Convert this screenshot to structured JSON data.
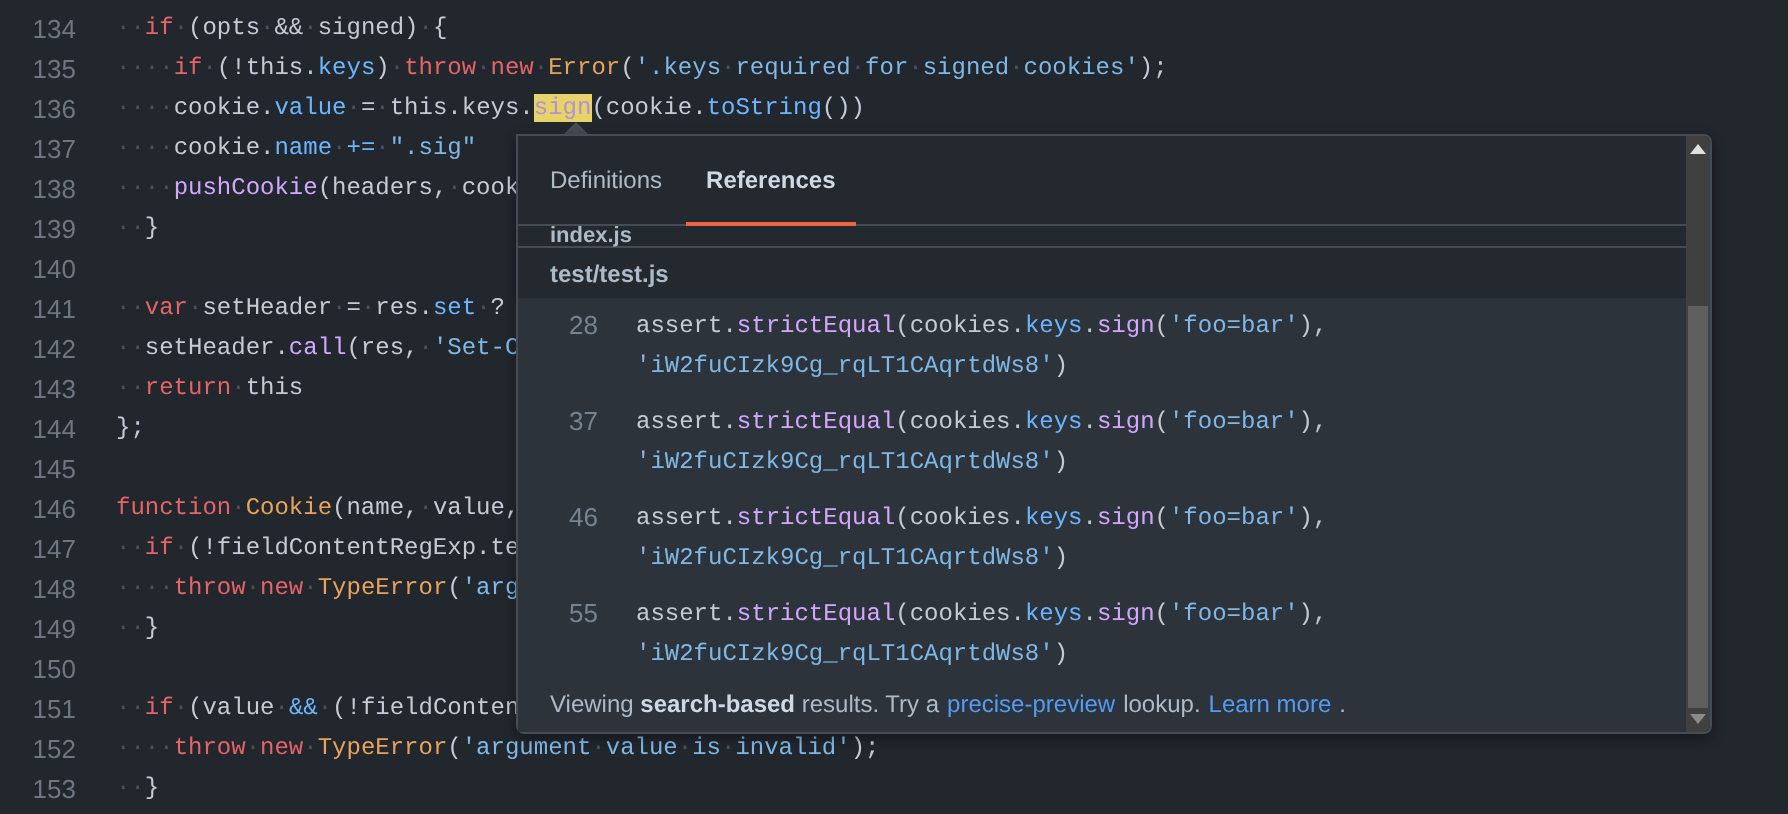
{
  "code_lines": [
    {
      "number": "134",
      "tokens": [
        {
          "kind": "ws",
          "text": "··"
        },
        {
          "kind": "kw",
          "text": "if"
        },
        {
          "kind": "ws",
          "text": "·"
        },
        {
          "kind": "plain",
          "text": "(opts"
        },
        {
          "kind": "ws",
          "text": "·"
        },
        {
          "kind": "plain",
          "text": "&&"
        },
        {
          "kind": "ws",
          "text": "·"
        },
        {
          "kind": "plain",
          "text": "signed)"
        },
        {
          "kind": "ws",
          "text": "·"
        },
        {
          "kind": "plain",
          "text": "{"
        }
      ]
    },
    {
      "number": "135",
      "tokens": [
        {
          "kind": "ws",
          "text": "····"
        },
        {
          "kind": "kw",
          "text": "if"
        },
        {
          "kind": "ws",
          "text": "·"
        },
        {
          "kind": "plain",
          "text": "(!this."
        },
        {
          "kind": "prop",
          "text": "keys"
        },
        {
          "kind": "plain",
          "text": ")"
        },
        {
          "kind": "ws",
          "text": "·"
        },
        {
          "kind": "kw",
          "text": "throw"
        },
        {
          "kind": "ws",
          "text": "·"
        },
        {
          "kind": "kw",
          "text": "new"
        },
        {
          "kind": "ws",
          "text": "·"
        },
        {
          "kind": "cls",
          "text": "Error"
        },
        {
          "kind": "plain",
          "text": "("
        },
        {
          "kind": "str",
          "text": "'.keys"
        },
        {
          "kind": "ws",
          "text": "·"
        },
        {
          "kind": "str",
          "text": "required"
        },
        {
          "kind": "ws",
          "text": "·"
        },
        {
          "kind": "str",
          "text": "for"
        },
        {
          "kind": "ws",
          "text": "·"
        },
        {
          "kind": "str",
          "text": "signed"
        },
        {
          "kind": "ws",
          "text": "·"
        },
        {
          "kind": "str",
          "text": "cookies'"
        },
        {
          "kind": "plain",
          "text": ");"
        }
      ]
    },
    {
      "number": "136",
      "tokens": [
        {
          "kind": "ws",
          "text": "····"
        },
        {
          "kind": "plain",
          "text": "cookie."
        },
        {
          "kind": "prop",
          "text": "value"
        },
        {
          "kind": "ws",
          "text": "·"
        },
        {
          "kind": "plain",
          "text": "="
        },
        {
          "kind": "ws",
          "text": "·"
        },
        {
          "kind": "plain",
          "text": "this.keys."
        },
        {
          "kind": "match",
          "text": "sign"
        },
        {
          "kind": "plain",
          "text": "(cookie."
        },
        {
          "kind": "prop",
          "text": "toString"
        },
        {
          "kind": "plain",
          "text": "())"
        }
      ]
    },
    {
      "number": "137",
      "tokens": [
        {
          "kind": "ws",
          "text": "····"
        },
        {
          "kind": "plain",
          "text": "cookie."
        },
        {
          "kind": "prop",
          "text": "name"
        },
        {
          "kind": "ws",
          "text": "·"
        },
        {
          "kind": "prop",
          "text": "+="
        },
        {
          "kind": "ws",
          "text": "·"
        },
        {
          "kind": "str",
          "text": "\".sig\""
        }
      ]
    },
    {
      "number": "138",
      "tokens": [
        {
          "kind": "ws",
          "text": "····"
        },
        {
          "kind": "fn",
          "text": "pushCookie"
        },
        {
          "kind": "plain",
          "text": "(headers,"
        },
        {
          "kind": "ws",
          "text": "·"
        },
        {
          "kind": "plain",
          "text": "cook"
        }
      ]
    },
    {
      "number": "139",
      "tokens": [
        {
          "kind": "ws",
          "text": "··"
        },
        {
          "kind": "plain",
          "text": "}"
        }
      ]
    },
    {
      "number": "140"
    },
    {
      "number": "141",
      "tokens": [
        {
          "kind": "ws",
          "text": "··"
        },
        {
          "kind": "kw",
          "text": "var"
        },
        {
          "kind": "ws",
          "text": "·"
        },
        {
          "kind": "plain",
          "text": "setHeader"
        },
        {
          "kind": "ws",
          "text": "·"
        },
        {
          "kind": "plain",
          "text": "="
        },
        {
          "kind": "ws",
          "text": "·"
        },
        {
          "kind": "plain",
          "text": "res."
        },
        {
          "kind": "prop",
          "text": "set"
        },
        {
          "kind": "ws",
          "text": "·"
        },
        {
          "kind": "plain",
          "text": "?"
        }
      ]
    },
    {
      "number": "142",
      "tokens": [
        {
          "kind": "ws",
          "text": "··"
        },
        {
          "kind": "plain",
          "text": "setHeader."
        },
        {
          "kind": "fn",
          "text": "call"
        },
        {
          "kind": "plain",
          "text": "(res,"
        },
        {
          "kind": "ws",
          "text": "·"
        },
        {
          "kind": "str",
          "text": "'Set-C"
        }
      ]
    },
    {
      "number": "143",
      "tokens": [
        {
          "kind": "ws",
          "text": "··"
        },
        {
          "kind": "kw",
          "text": "return"
        },
        {
          "kind": "ws",
          "text": "·"
        },
        {
          "kind": "plain",
          "text": "this"
        }
      ]
    },
    {
      "number": "144",
      "tokens": [
        {
          "kind": "plain",
          "text": "};"
        }
      ]
    },
    {
      "number": "145"
    },
    {
      "number": "146",
      "tokens": [
        {
          "kind": "kw",
          "text": "function"
        },
        {
          "kind": "ws",
          "text": "·"
        },
        {
          "kind": "cls",
          "text": "Cookie"
        },
        {
          "kind": "plain",
          "text": "(name,"
        },
        {
          "kind": "ws",
          "text": "·"
        },
        {
          "kind": "plain",
          "text": "value,"
        }
      ]
    },
    {
      "number": "147",
      "tokens": [
        {
          "kind": "ws",
          "text": "··"
        },
        {
          "kind": "kw",
          "text": "if"
        },
        {
          "kind": "ws",
          "text": "·"
        },
        {
          "kind": "plain",
          "text": "(!fieldContentRegExp.te"
        }
      ]
    },
    {
      "number": "148",
      "tokens": [
        {
          "kind": "ws",
          "text": "····"
        },
        {
          "kind": "kw",
          "text": "throw"
        },
        {
          "kind": "ws",
          "text": "·"
        },
        {
          "kind": "kw",
          "text": "new"
        },
        {
          "kind": "ws",
          "text": "·"
        },
        {
          "kind": "cls",
          "text": "TypeError"
        },
        {
          "kind": "plain",
          "text": "("
        },
        {
          "kind": "str",
          "text": "'arg"
        }
      ]
    },
    {
      "number": "149",
      "tokens": [
        {
          "kind": "ws",
          "text": "··"
        },
        {
          "kind": "plain",
          "text": "}"
        }
      ]
    },
    {
      "number": "150"
    },
    {
      "number": "151",
      "tokens": [
        {
          "kind": "ws",
          "text": "··"
        },
        {
          "kind": "kw",
          "text": "if"
        },
        {
          "kind": "ws",
          "text": "·"
        },
        {
          "kind": "plain",
          "text": "(value"
        },
        {
          "kind": "ws",
          "text": "·"
        },
        {
          "kind": "prop",
          "text": "&&"
        },
        {
          "kind": "ws",
          "text": "·"
        },
        {
          "kind": "plain",
          "text": "(!fieldConten"
        }
      ]
    },
    {
      "number": "152",
      "tokens": [
        {
          "kind": "ws",
          "text": "····"
        },
        {
          "kind": "kw",
          "text": "throw"
        },
        {
          "kind": "ws",
          "text": "·"
        },
        {
          "kind": "kw",
          "text": "new"
        },
        {
          "kind": "ws",
          "text": "·"
        },
        {
          "kind": "cls",
          "text": "TypeError"
        },
        {
          "kind": "plain",
          "text": "("
        },
        {
          "kind": "str",
          "text": "'argument"
        },
        {
          "kind": "ws",
          "text": "·"
        },
        {
          "kind": "str",
          "text": "value"
        },
        {
          "kind": "ws",
          "text": "·"
        },
        {
          "kind": "str",
          "text": "is"
        },
        {
          "kind": "ws",
          "text": "·"
        },
        {
          "kind": "str",
          "text": "invalid'"
        },
        {
          "kind": "plain",
          "text": ");"
        }
      ]
    },
    {
      "number": "153",
      "tokens": [
        {
          "kind": "ws",
          "text": "··"
        },
        {
          "kind": "plain",
          "text": "}"
        }
      ]
    }
  ],
  "popup": {
    "tabs": [
      {
        "label": "Definitions",
        "selected": false
      },
      {
        "label": "References",
        "selected": true
      }
    ],
    "clipped_file": "index.js",
    "file": "test/test.js",
    "results": [
      {
        "number": "28",
        "lines": [
          [
            {
              "kind": "plain",
              "text": "assert."
            },
            {
              "kind": "fn",
              "text": "strictEqual"
            },
            {
              "kind": "plain",
              "text": "(cookies."
            },
            {
              "kind": "prop",
              "text": "keys"
            },
            {
              "kind": "plain",
              "text": "."
            },
            {
              "kind": "fn",
              "text": "sign"
            },
            {
              "kind": "plain",
              "text": "("
            },
            {
              "kind": "str",
              "text": "'foo=bar'"
            },
            {
              "kind": "plain",
              "text": "),"
            }
          ],
          [
            {
              "kind": "str",
              "text": "'iW2fuCIzk9Cg_rqLT1CAqrtdWs8'"
            },
            {
              "kind": "plain",
              "text": ")"
            }
          ]
        ]
      },
      {
        "number": "37",
        "lines": [
          [
            {
              "kind": "plain",
              "text": "assert."
            },
            {
              "kind": "fn",
              "text": "strictEqual"
            },
            {
              "kind": "plain",
              "text": "(cookies."
            },
            {
              "kind": "prop",
              "text": "keys"
            },
            {
              "kind": "plain",
              "text": "."
            },
            {
              "kind": "fn",
              "text": "sign"
            },
            {
              "kind": "plain",
              "text": "("
            },
            {
              "kind": "str",
              "text": "'foo=bar'"
            },
            {
              "kind": "plain",
              "text": "),"
            }
          ],
          [
            {
              "kind": "str",
              "text": "'iW2fuCIzk9Cg_rqLT1CAqrtdWs8'"
            },
            {
              "kind": "plain",
              "text": ")"
            }
          ]
        ]
      },
      {
        "number": "46",
        "lines": [
          [
            {
              "kind": "plain",
              "text": "assert."
            },
            {
              "kind": "fn",
              "text": "strictEqual"
            },
            {
              "kind": "plain",
              "text": "(cookies."
            },
            {
              "kind": "prop",
              "text": "keys"
            },
            {
              "kind": "plain",
              "text": "."
            },
            {
              "kind": "fn",
              "text": "sign"
            },
            {
              "kind": "plain",
              "text": "("
            },
            {
              "kind": "str",
              "text": "'foo=bar'"
            },
            {
              "kind": "plain",
              "text": "),"
            }
          ],
          [
            {
              "kind": "str",
              "text": "'iW2fuCIzk9Cg_rqLT1CAqrtdWs8'"
            },
            {
              "kind": "plain",
              "text": ")"
            }
          ]
        ]
      },
      {
        "number": "55",
        "lines": [
          [
            {
              "kind": "plain",
              "text": "assert."
            },
            {
              "kind": "fn",
              "text": "strictEqual"
            },
            {
              "kind": "plain",
              "text": "(cookies."
            },
            {
              "kind": "prop",
              "text": "keys"
            },
            {
              "kind": "plain",
              "text": "."
            },
            {
              "kind": "fn",
              "text": "sign"
            },
            {
              "kind": "plain",
              "text": "("
            },
            {
              "kind": "str",
              "text": "'foo=bar'"
            },
            {
              "kind": "plain",
              "text": "),"
            }
          ],
          [
            {
              "kind": "str",
              "text": "'iW2fuCIzk9Cg_rqLT1CAqrtdWs8'"
            },
            {
              "kind": "plain",
              "text": ")"
            }
          ]
        ]
      }
    ],
    "footer": {
      "lead": "Viewing **search-based** results. Try a",
      "link": "precise-preview",
      "middle": "lookup.",
      "learn_more": "Learn more",
      "end": "."
    }
  }
}
